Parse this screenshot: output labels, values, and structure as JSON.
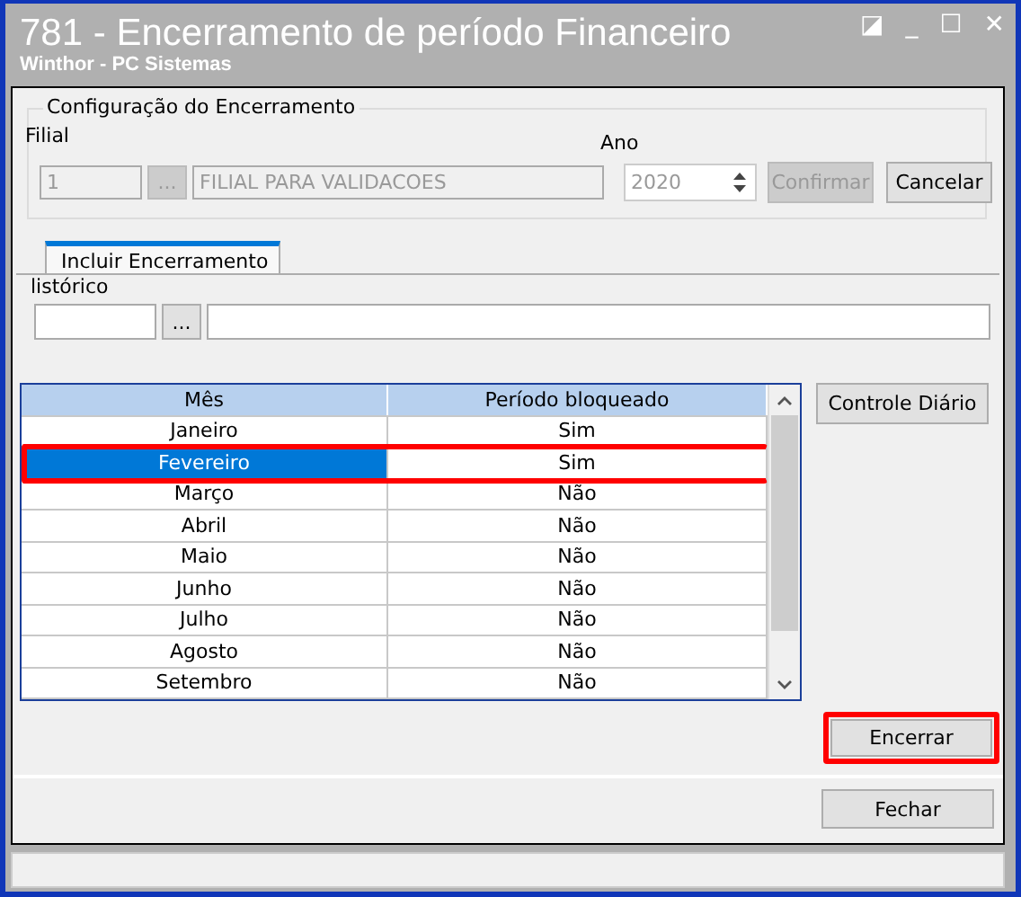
{
  "window": {
    "title": "781 - Encerramento de período Financeiro",
    "subtitle": "Winthor - PC Sistemas",
    "controls": [
      "◪",
      "_",
      "☐",
      "✕"
    ]
  },
  "config": {
    "legend": "Configuração do Encerramento",
    "filial_label": "Filial",
    "filial_code": "1",
    "lookup_button": "...",
    "filial_name": "FILIAL PARA VALIDACOES",
    "ano_label": "Ano",
    "ano": "2020",
    "buttons": [
      {
        "label": "Confirmar",
        "disabled": true
      },
      {
        "label": "Cancelar",
        "disabled": false
      }
    ]
  },
  "tabs": [
    {
      "label": "Incluir Encerramento",
      "selected": true
    }
  ],
  "historico": {
    "label": "listórico",
    "lookup_button": "..."
  },
  "table": {
    "columns": [
      "Mês",
      "Período bloqueado"
    ],
    "rows": [
      {
        "cells": [
          "Janeiro",
          "Sim"
        ],
        "selected": false,
        "highlighted": false
      },
      {
        "cells": [
          "Fevereiro",
          "Sim"
        ],
        "selected": true,
        "highlighted": true
      },
      {
        "cells": [
          "Março",
          "Não"
        ],
        "selected": false,
        "highlighted": false
      },
      {
        "cells": [
          "Abril",
          "Não"
        ],
        "selected": false,
        "highlighted": false
      },
      {
        "cells": [
          "Maio",
          "Não"
        ],
        "selected": false,
        "highlighted": false
      },
      {
        "cells": [
          "Junho",
          "Não"
        ],
        "selected": false,
        "highlighted": false
      },
      {
        "cells": [
          "Julho",
          "Não"
        ],
        "selected": false,
        "highlighted": false
      },
      {
        "cells": [
          "Agosto",
          "Não"
        ],
        "selected": false,
        "highlighted": false
      },
      {
        "cells": [
          "Setembro",
          "Não"
        ],
        "selected": false,
        "highlighted": false
      }
    ]
  },
  "side_buttons": [
    {
      "label": "Controle Diário",
      "highlighted": false
    },
    {
      "label": "Encerrar",
      "highlighted": true
    }
  ],
  "footer_button": "Fechar"
}
